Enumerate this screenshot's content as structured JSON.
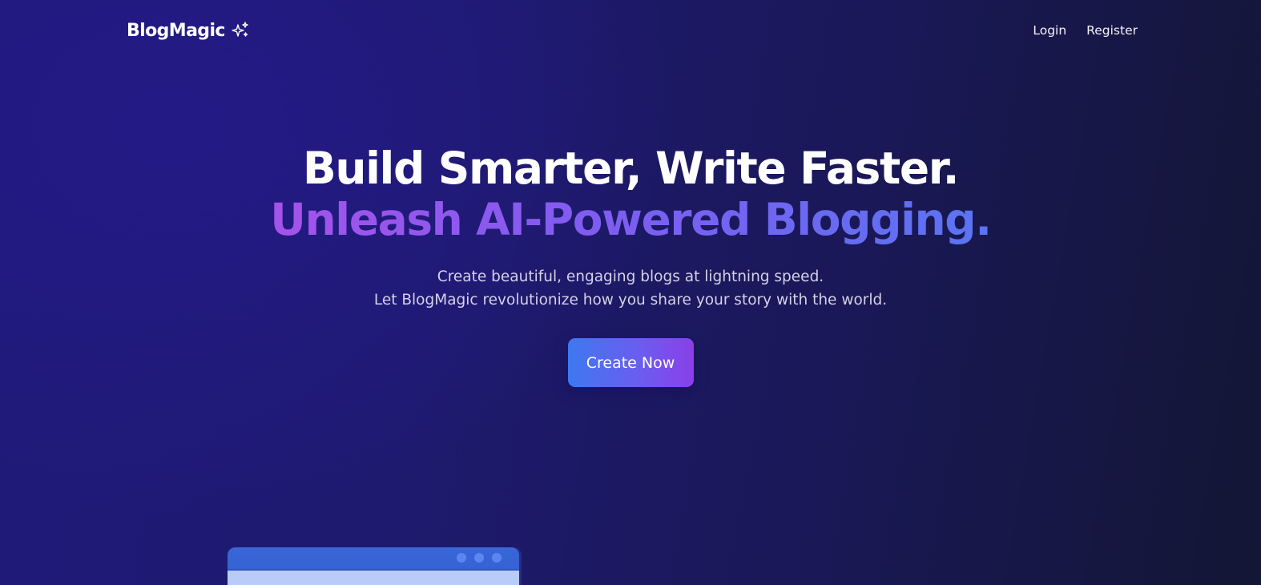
{
  "nav": {
    "brand": "BlogMagic",
    "brand_icon": "sparkles-icon",
    "login_label": "Login",
    "register_label": "Register"
  },
  "hero": {
    "title_line1": "Build Smarter, Write Faster.",
    "title_line2": "Unleash AI-Powered Blogging.",
    "subtitle_line1": "Create beautiful, engaging blogs at lightning speed.",
    "subtitle_line2": "Let BlogMagic revolutionize how you share your story with the world.",
    "cta_label": "Create Now"
  },
  "colors": {
    "background_start": "#1f1a7a",
    "background_end": "#131634",
    "gradient_text_start": "#a553ea",
    "gradient_text_end": "#5a74f2",
    "cta_start": "#3d78f0",
    "cta_end": "#8a3fe8",
    "mockup_titlebar": "#3563d3",
    "mockup_body": "#b9ccf8"
  }
}
